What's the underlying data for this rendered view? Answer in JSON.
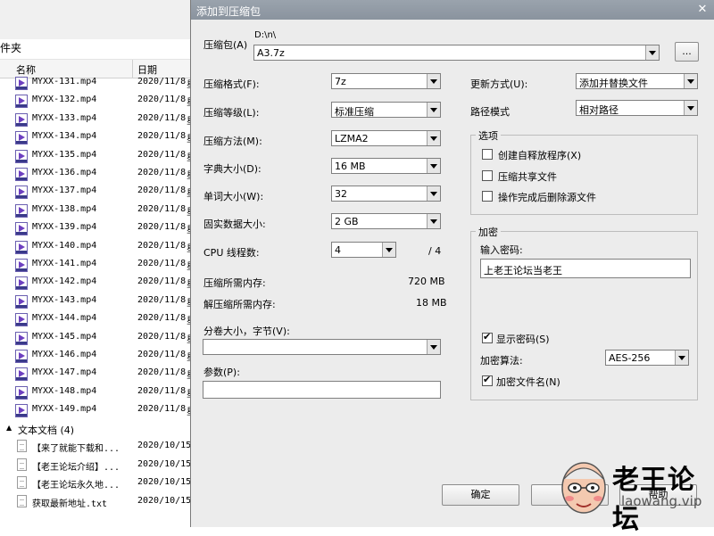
{
  "explorer": {
    "folder_label": "件夹",
    "header": {
      "name": "名称",
      "date": "日期"
    },
    "mp4_files": [
      {
        "name": "MYXX-131.mp4",
        "date": "2020/11/8",
        "extra": "星"
      },
      {
        "name": "MYXX-132.mp4",
        "date": "2020/11/8",
        "extra": "星"
      },
      {
        "name": "MYXX-133.mp4",
        "date": "2020/11/8",
        "extra": "星"
      },
      {
        "name": "MYXX-134.mp4",
        "date": "2020/11/8",
        "extra": "星"
      },
      {
        "name": "MYXX-135.mp4",
        "date": "2020/11/8",
        "extra": "星"
      },
      {
        "name": "MYXX-136.mp4",
        "date": "2020/11/8",
        "extra": "星"
      },
      {
        "name": "MYXX-137.mp4",
        "date": "2020/11/8",
        "extra": "星"
      },
      {
        "name": "MYXX-138.mp4",
        "date": "2020/11/8",
        "extra": "星"
      },
      {
        "name": "MYXX-139.mp4",
        "date": "2020/11/8",
        "extra": "星"
      },
      {
        "name": "MYXX-140.mp4",
        "date": "2020/11/8",
        "extra": "星"
      },
      {
        "name": "MYXX-141.mp4",
        "date": "2020/11/8",
        "extra": "星"
      },
      {
        "name": "MYXX-142.mp4",
        "date": "2020/11/8",
        "extra": "星"
      },
      {
        "name": "MYXX-143.mp4",
        "date": "2020/11/8",
        "extra": "星"
      },
      {
        "name": "MYXX-144.mp4",
        "date": "2020/11/8",
        "extra": "星"
      },
      {
        "name": "MYXX-145.mp4",
        "date": "2020/11/8",
        "extra": "星"
      },
      {
        "name": "MYXX-146.mp4",
        "date": "2020/11/8",
        "extra": "星"
      },
      {
        "name": "MYXX-147.mp4",
        "date": "2020/11/8",
        "extra": "星"
      },
      {
        "name": "MYXX-148.mp4",
        "date": "2020/11/8",
        "extra": "星"
      },
      {
        "name": "MYXX-149.mp4",
        "date": "2020/11/8",
        "extra": "星"
      }
    ],
    "text_group": "文本文档 (4)",
    "text_files": [
      {
        "name": "【来了就能下载和...",
        "date": "2020/10/15"
      },
      {
        "name": "【老王论坛介绍】...",
        "date": "2020/10/15"
      },
      {
        "name": "【老王论坛永久地...",
        "date": "2020/10/15"
      },
      {
        "name": "获取最新地址.txt",
        "date": "2020/10/15"
      }
    ],
    "icon_video": "video-file-icon",
    "icon_text": "text-file-icon"
  },
  "dialog": {
    "title": "添加到压缩包",
    "close_glyph": "✕",
    "archive_label": "压缩包(A)",
    "archive_path": "D:\\n\\",
    "archive_name": "A3.7z",
    "browse_label": "...",
    "format_label": "压缩格式(F):",
    "format_value": "7z",
    "level_label": "压缩等级(L):",
    "level_value": "标准压缩",
    "method_label": "压缩方法(M):",
    "method_value": "LZMA2",
    "dict_label": "字典大小(D):",
    "dict_value": "16 MB",
    "word_label": "单词大小(W):",
    "word_value": "32",
    "solid_label": "固实数据大小:",
    "solid_value": "2 GB",
    "cpu_label": "CPU 线程数:",
    "cpu_value": "4",
    "cpu_max": "/ 4",
    "mem_compress_label": "压缩所需内存:",
    "mem_compress_value": "720 MB",
    "mem_decompress_label": "解压缩所需内存:",
    "mem_decompress_value": "18 MB",
    "split_label": "分卷大小，字节(V):",
    "split_value": "",
    "params_label": "参数(P):",
    "params_value": "",
    "update_label": "更新方式(U):",
    "update_value": "添加并替换文件",
    "path_mode_label": "路径模式",
    "path_mode_value": "相对路径",
    "options": {
      "title": "选项",
      "items": [
        {
          "label": "创建自释放程序(X)",
          "checked": false
        },
        {
          "label": "压缩共享文件",
          "checked": false
        },
        {
          "label": "操作完成后删除源文件",
          "checked": false
        }
      ]
    },
    "encryption": {
      "title": "加密",
      "password_label": "输入密码:",
      "password_value": "上老王论坛当老王",
      "show_password_label": "显示密码(S)",
      "show_password_checked": true,
      "method_label": "加密算法:",
      "method_value": "AES-256",
      "encrypt_names_label": "加密文件名(N)",
      "encrypt_names_checked": true
    },
    "ok_label": "确定",
    "cancel_label": "取",
    "help_label": "帮助",
    "check_glyph": "✔"
  },
  "watermark": {
    "title": "老王论坛",
    "url": "laowang.vip"
  }
}
